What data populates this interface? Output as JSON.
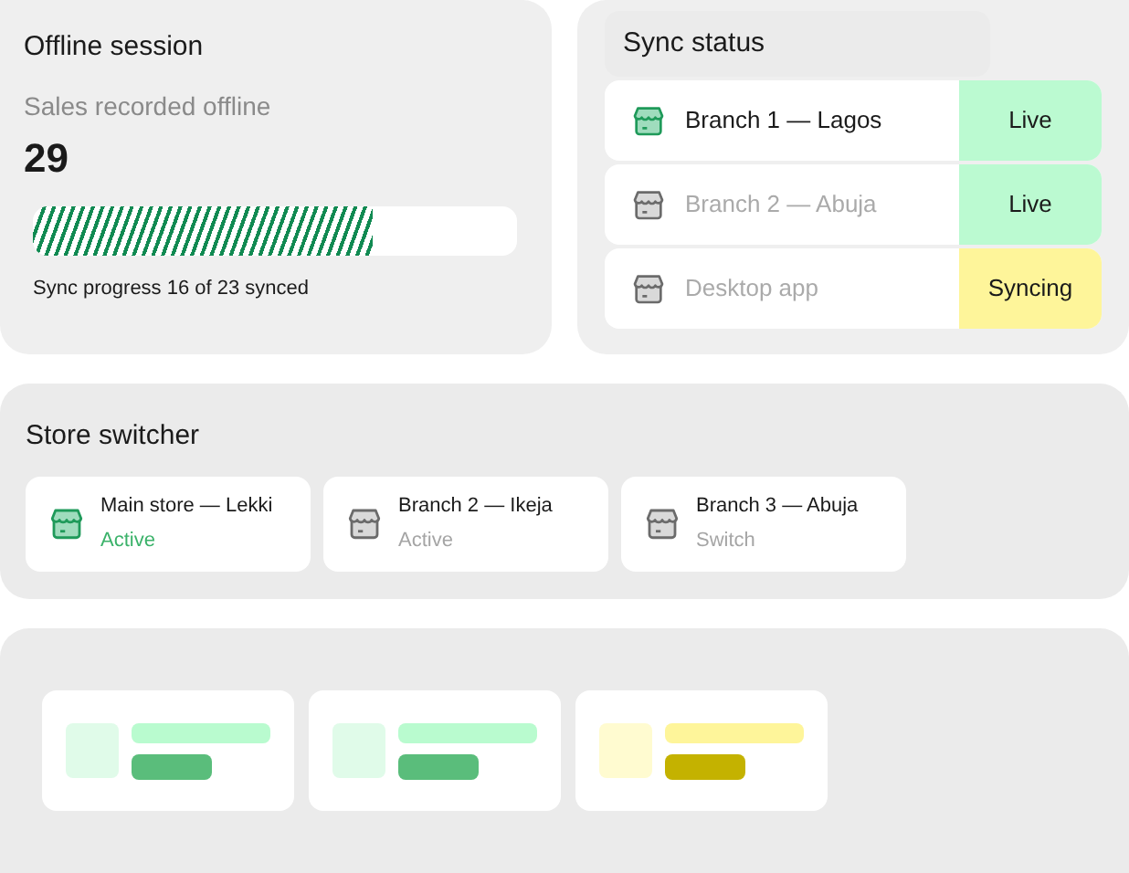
{
  "offline_session": {
    "title": "Offline session",
    "metric_label": "Sales recorded offline",
    "metric_value": "29",
    "progress": {
      "level": 0.7,
      "caption": "Sync progress 16 of 23 synced"
    }
  },
  "sync_status": {
    "title": "Sync status",
    "rows": [
      {
        "name": "Branch 1 — Lagos",
        "selected": true,
        "status": "Live",
        "kind": "live"
      },
      {
        "name": "Branch 2 — Abuja",
        "selected": false,
        "status": "Live",
        "kind": "live"
      },
      {
        "name": "Desktop app",
        "selected": false,
        "status": "Syncing",
        "kind": "syncing"
      }
    ]
  },
  "store_switcher": {
    "title": "Store switcher",
    "stores": [
      {
        "name": "Main store — Lekki",
        "action": "Active",
        "selected": true
      },
      {
        "name": "Branch 2 — Ikeja",
        "action": "Active",
        "selected": false
      },
      {
        "name": "Branch 3 — Abuja",
        "action": "Switch",
        "selected": false
      }
    ]
  },
  "placeholder_cards": [
    {
      "color": "#5abd7b"
    },
    {
      "color": "#5abd7b"
    },
    {
      "color": "#c4b200"
    }
  ]
}
